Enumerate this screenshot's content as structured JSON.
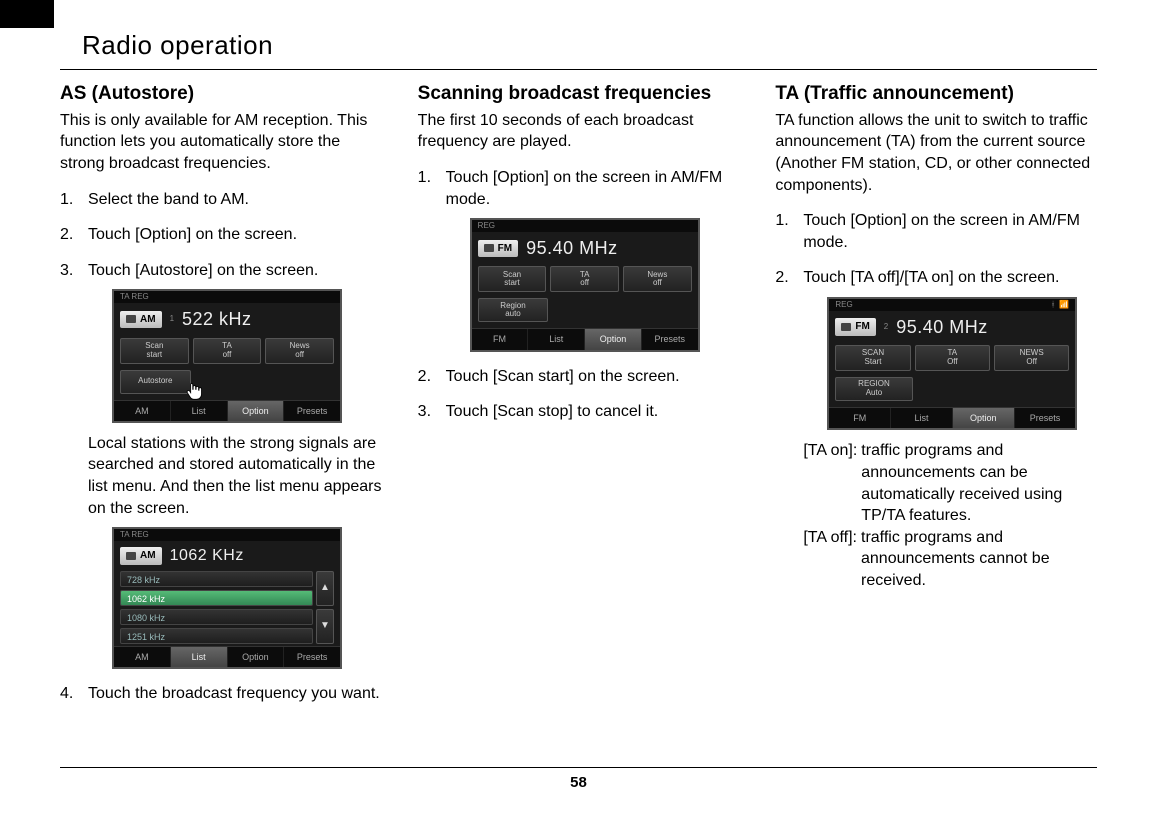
{
  "page": {
    "title": "Radio operation",
    "number": "58"
  },
  "col1": {
    "heading": "AS (Autostore)",
    "intro": "This is only available for AM reception. This function lets you automatically store the strong broadcast frequencies.",
    "steps": [
      "Select the band to AM.",
      "Touch [Option] on the screen.",
      "Touch [Autostore] on the screen."
    ],
    "after3": "Local stations with the strong signals are searched and stored automatically in the list menu. And then the list menu appears on the screen.",
    "step4": "Touch the broadcast frequency you want.",
    "shot1": {
      "topbar": "TA   REG",
      "band": "AM",
      "band_sub": "1",
      "freq": "522 kHz",
      "btns": [
        [
          "Scan",
          "start"
        ],
        [
          "TA",
          "off"
        ],
        [
          "News",
          "off"
        ]
      ],
      "auto": "Autostore",
      "tabs": [
        "AM",
        "List",
        "Option",
        "Presets"
      ],
      "selected_tab": 2
    },
    "shot2": {
      "topbar": "TA   REG",
      "band": "AM",
      "freq": "1062 KHz",
      "rows": [
        "728 kHz",
        "1062 kHz",
        "1080 kHz",
        "1251 kHz"
      ],
      "selected_row": 1,
      "tabs": [
        "AM",
        "List",
        "Option",
        "Presets"
      ],
      "selected_tab": 1
    }
  },
  "col2": {
    "heading": "Scanning broadcast frequen­cies",
    "intro": "The first 10 seconds of each broadcast frequency are played.",
    "steps": [
      "Touch [Option] on the screen in AM/FM mode.",
      "Touch  [Scan start] on the screen.",
      "Touch [Scan stop] to cancel it."
    ],
    "shot": {
      "topbar": "REG",
      "band": "FM",
      "freq": "95.40 MHz",
      "btns": [
        [
          "Scan",
          "start"
        ],
        [
          "TA",
          "off"
        ],
        [
          "News",
          "off"
        ]
      ],
      "region": [
        "Region",
        "auto"
      ],
      "tabs": [
        "FM",
        "List",
        "Option",
        "Presets"
      ],
      "selected_tab": 2
    }
  },
  "col3": {
    "heading": "TA (Traffic announcement)",
    "intro": "TA function allows the unit to switch to traffic announcement (TA) from the current source (Another FM station, CD, or other connected components).",
    "steps": [
      "Touch [Option] on the screen in AM/FM mode.",
      "Touch [TA off]/[TA on] on the screen."
    ],
    "shot": {
      "topbar": "REG",
      "band": "FM",
      "band_sub": "2",
      "freq": "95.40 MHz",
      "btns": [
        [
          "SCAN",
          "Start"
        ],
        [
          "TA",
          "Off"
        ],
        [
          "NEWS",
          "Off"
        ]
      ],
      "region": [
        "REGION",
        "Auto"
      ],
      "tabs": [
        "FM",
        "List",
        "Option",
        "Presets"
      ],
      "selected_tab": 2
    },
    "defs": [
      {
        "label": "[TA on]: ",
        "body": "traffic programs and announcements can be automatically received using TP/TA features."
      },
      {
        "label": "[TA off]: ",
        "body": "traffic programs and announcements cannot be received."
      }
    ]
  }
}
